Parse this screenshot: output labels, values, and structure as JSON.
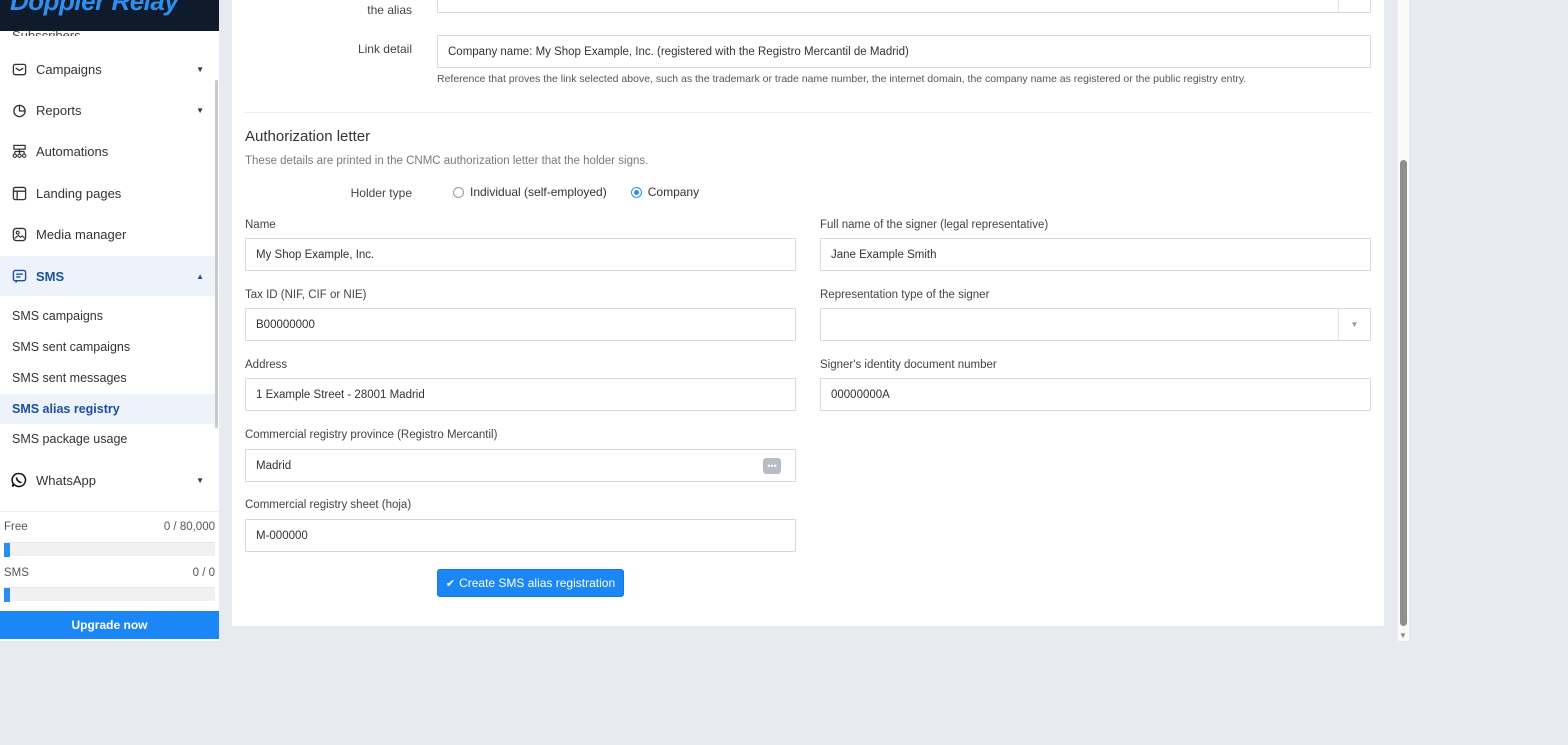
{
  "brand": {
    "name": "Doppler Relay"
  },
  "sidebar": {
    "clipped_item": "Subscribers",
    "items": [
      {
        "label": "Campaigns",
        "icon": "envelope-icon"
      },
      {
        "label": "Reports",
        "icon": "pie-chart-icon"
      },
      {
        "label": "Automations",
        "icon": "flow-icon"
      },
      {
        "label": "Landing pages",
        "icon": "layout-icon"
      },
      {
        "label": "Media manager",
        "icon": "image-icon"
      },
      {
        "label": "SMS",
        "icon": "message-icon"
      },
      {
        "label": "WhatsApp",
        "icon": "whatsapp-icon"
      }
    ],
    "sms_subitems": [
      "SMS campaigns",
      "SMS sent campaigns",
      "SMS sent messages",
      "SMS alias registry",
      "SMS package usage"
    ],
    "active_subitem": "SMS alias registry"
  },
  "usage": {
    "free_label": "Free",
    "free_value": "0 / 80,000",
    "free_fraction": 0,
    "sms_label": "SMS",
    "sms_value": "0 / 0",
    "sms_fraction": 0
  },
  "upgrade_label": "Upgrade now",
  "form": {
    "alias_label_tail": "the alias",
    "link_detail_label": "Link detail",
    "link_detail_value": "Company name: My Shop Example, Inc. (registered with the Registro Mercantil de Madrid)",
    "link_detail_help": "Reference that proves the link selected above, such as the trademark or trade name number, the internet domain, the company name as registered or the public registry entry.",
    "section_title": "Authorization letter",
    "section_desc": "These details are printed in the CNMC authorization letter that the holder signs.",
    "holder_type_label": "Holder type",
    "holder_options": [
      "Individual (self-employed)",
      "Company"
    ],
    "holder_selected": "Company",
    "name_label": "Name",
    "name_value": "My Shop Example, Inc.",
    "tax_label": "Tax ID (NIF, CIF or NIE)",
    "tax_value": "B00000000",
    "address_label": "Address",
    "address_value": "1 Example Street - 28001 Madrid",
    "province_label": "Commercial registry province (Registro Mercantil)",
    "province_value": "Madrid",
    "sheet_label": "Commercial registry sheet (hoja)",
    "sheet_value": "M-000000",
    "signer_name_label": "Full name of the signer (legal representative)",
    "signer_name_value": "Jane Example Smith",
    "rep_type_label": "Representation type of the signer",
    "rep_type_value": "",
    "signer_doc_label": "Signer's identity document number",
    "signer_doc_value": "00000000A",
    "submit_label": "Create SMS alias registration"
  },
  "colors": {
    "accent": "#1b86f5",
    "active_bg": "#eef3fb",
    "active_text": "#1b4fa0",
    "brand_bg": "#0f1b2b"
  }
}
